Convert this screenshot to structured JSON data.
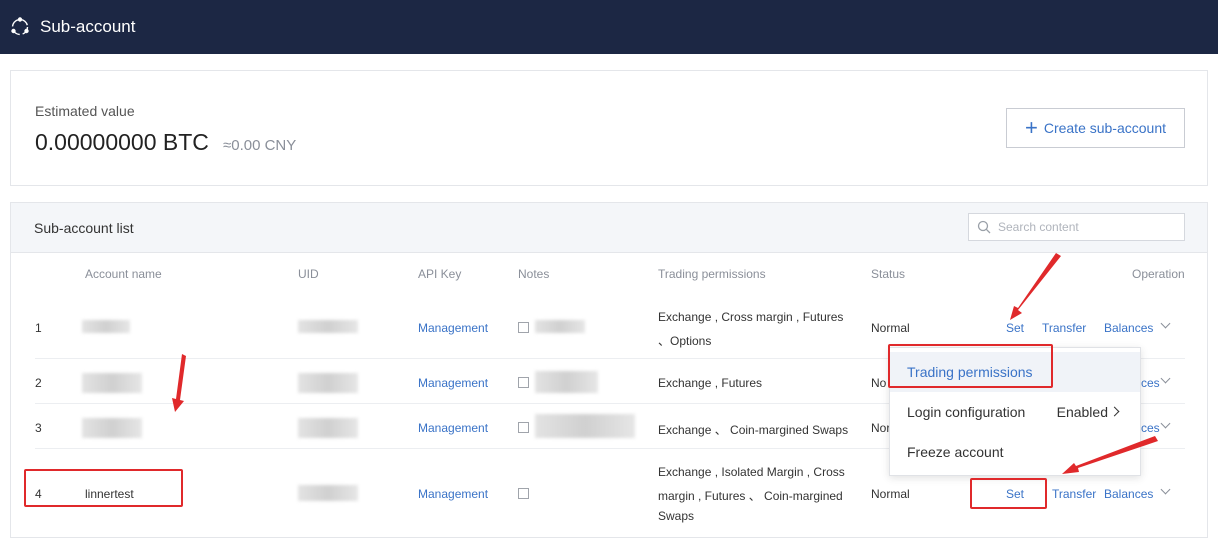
{
  "header": {
    "title": "Sub-account",
    "logo_icon": "orbit-logo-icon",
    "bg_color": "#1c2744"
  },
  "summary": {
    "label": "Estimated value",
    "btc_value": "0.00000000 BTC",
    "cny_value": "≈0.00 CNY",
    "create_button": "Create sub-account"
  },
  "list": {
    "title": "Sub-account list",
    "search_placeholder": "Search content",
    "columns": [
      "Account name",
      "UID",
      "API Key",
      "Notes",
      "Trading permissions",
      "Status",
      "Operation"
    ],
    "rows": [
      {
        "index": "1",
        "name": "",
        "api_key": "Management",
        "permissions": [
          "Exchange , Cross margin , Futures",
          "、Options"
        ],
        "status": "Normal",
        "set": "Set",
        "transfer": "Transfer",
        "balances": "Balances"
      },
      {
        "index": "2",
        "name": "",
        "api_key": "Management",
        "permissions": [
          "Exchange , Futures"
        ],
        "status": "No",
        "set": "",
        "transfer": "",
        "balances": "ces"
      },
      {
        "index": "3",
        "name": "",
        "api_key": "Management",
        "permissions": [
          "Exchange 、 Coin-margined Swaps"
        ],
        "status": "Nor",
        "set": "",
        "transfer": "",
        "balances": "ces"
      },
      {
        "index": "4",
        "name": "linnertest",
        "api_key": "Management",
        "permissions": [
          "Exchange , Isolated Margin , Cross",
          "margin , Futures 、 Coin-margined",
          "Swaps"
        ],
        "status": "Normal",
        "set": "Set",
        "transfer": "Transfer",
        "balances": "Balances"
      }
    ]
  },
  "dropdown": {
    "items": [
      {
        "label": "Trading permissions",
        "value": ""
      },
      {
        "label": "Login configuration",
        "value": "Enabled"
      },
      {
        "label": "Freeze account",
        "value": ""
      }
    ]
  },
  "colors": {
    "link": "#3a73c7",
    "annotation": "#e0292b"
  }
}
